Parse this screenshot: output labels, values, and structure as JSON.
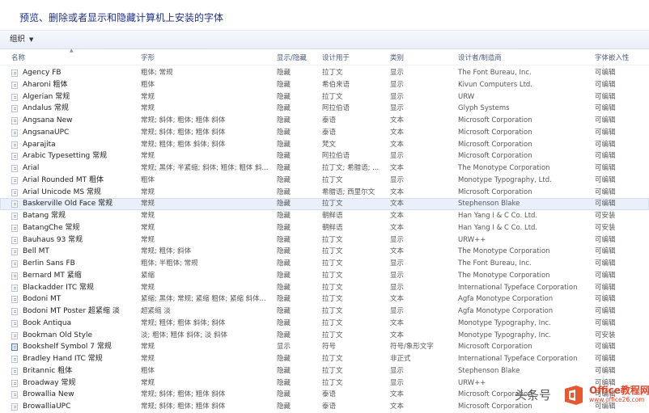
{
  "header": {
    "title": "预览、删除或者显示和隐藏计算机上安装的字体"
  },
  "toolbar": {
    "organize_label": "组织"
  },
  "columns": [
    "名称",
    "字形",
    "显示/隐藏",
    "设计用于",
    "类别",
    "设计者/制造商",
    "字体嵌入性"
  ],
  "rows": [
    [
      "Agency FB",
      "粗体; 常规",
      "隐藏",
      "拉丁文",
      "显示",
      "The Font Bureau, Inc.",
      "可编辑"
    ],
    [
      "Aharoni 粗体",
      "粗体",
      "隐藏",
      "希伯来语",
      "显示",
      "Kivun Computers Ltd.",
      "可编辑"
    ],
    [
      "Algerian 常规",
      "常规",
      "隐藏",
      "拉丁文",
      "显示",
      "URW",
      "可编辑"
    ],
    [
      "Andalus 常规",
      "常规",
      "隐藏",
      "阿拉伯语",
      "显示",
      "Glyph Systems",
      "可编辑"
    ],
    [
      "Angsana New",
      "常规; 斜体; 粗体; 粗体 斜体",
      "隐藏",
      "泰语",
      "文本",
      "Microsoft Corporation",
      "可编辑"
    ],
    [
      "AngsanaUPC",
      "常规; 斜体; 粗体; 粗体 斜体",
      "隐藏",
      "泰语",
      "文本",
      "Microsoft Corporation",
      "可编辑"
    ],
    [
      "Aparajita",
      "常规; 粗体; 粗体 斜体; 斜体",
      "隐藏",
      "梵文",
      "文本",
      "Microsoft Corporation",
      "可编辑"
    ],
    [
      "Arabic Typesetting 常规",
      "常规",
      "隐藏",
      "阿拉伯语",
      "显示",
      "Microsoft Corporation",
      "可编辑"
    ],
    [
      "Arial",
      "常规; 黑体; 半紧缩; 斜体; 粗体; 粗体 斜...",
      "隐藏",
      "拉丁文; 希腊语; ...",
      "文本",
      "The Monotype Corporation",
      "可编辑"
    ],
    [
      "Arial Rounded MT 粗体",
      "粗体",
      "隐藏",
      "拉丁文",
      "显示",
      "Monotype Typography, Ltd.",
      "可编辑"
    ],
    [
      "Arial Unicode MS 常规",
      "常规",
      "隐藏",
      "希腊语; 西里尔文",
      "文本",
      "Microsoft Corporation",
      "可编辑"
    ],
    [
      "Baskerville Old Face 常规",
      "常规",
      "隐藏",
      "拉丁文",
      "文本",
      "Stephenson Blake",
      "可编辑"
    ],
    [
      "Batang 常规",
      "常规",
      "隐藏",
      "朝鲜语",
      "文本",
      "Han Yang I & C Co. Ltd.",
      "可安装"
    ],
    [
      "BatangChe 常规",
      "常规",
      "隐藏",
      "朝鲜语",
      "文本",
      "Han Yang I & C Co. Ltd.",
      "可安装"
    ],
    [
      "Bauhaus 93 常规",
      "常规",
      "隐藏",
      "拉丁文",
      "显示",
      "URW++",
      "可编辑"
    ],
    [
      "Bell MT",
      "常规; 粗体; 斜体",
      "隐藏",
      "拉丁文",
      "文本",
      "The Monotype Corporation",
      "可编辑"
    ],
    [
      "Berlin Sans FB",
      "粗体; 半粗体; 常规",
      "隐藏",
      "拉丁文",
      "显示",
      "The Font Bureau, Inc.",
      "可编辑"
    ],
    [
      "Bernard MT 紧缩",
      "紧缩",
      "隐藏",
      "拉丁文",
      "显示",
      "The Monotype Corporation",
      "可编辑"
    ],
    [
      "Blackadder ITC 常规",
      "常规",
      "隐藏",
      "拉丁文",
      "显示",
      "International Typeface Corporation",
      "可编辑"
    ],
    [
      "Bodoni MT",
      "紧缩; 黑体; 常规; 紧缩 粗体; 紧缩 斜体...",
      "隐藏",
      "拉丁文",
      "文本",
      "Agfa Monotype Corporation",
      "可编辑"
    ],
    [
      "Bodoni MT Poster 超紧缩 淡",
      "超紧缩 淡",
      "隐藏",
      "拉丁文",
      "显示",
      "Agfa Monotype Corporation",
      "可编辑"
    ],
    [
      "Book Antiqua",
      "常规; 粗体; 粗体 斜体; 斜体",
      "隐藏",
      "拉丁文",
      "文本",
      "Monotype Typography, Inc.",
      "可编辑"
    ],
    [
      "Bookman Old Style",
      "淡; 粗体; 粗体 斜体; 淡 斜体",
      "隐藏",
      "拉丁文",
      "文本",
      "Monotype Typography, Inc.",
      "可安装"
    ],
    [
      "Bookshelf Symbol 7 常规",
      "常规",
      "显示",
      "符号",
      "符号/象形文字",
      "Microsoft Corporation",
      "可编辑"
    ],
    [
      "Bradley Hand ITC 常规",
      "常规",
      "隐藏",
      "拉丁文",
      "非正式",
      "International Typeface Corporation",
      "可编辑"
    ],
    [
      "Britannic 粗体",
      "粗体",
      "隐藏",
      "拉丁文",
      "显示",
      "Stephenson Blake",
      "可编辑"
    ],
    [
      "Broadway 常规",
      "常规",
      "隐藏",
      "拉丁文",
      "显示",
      "URW++",
      "可编辑"
    ],
    [
      "Browallia New",
      "常规; 斜体; 粗体; 粗体 斜体",
      "隐藏",
      "泰语",
      "文本",
      "Microsoft Corporation",
      "可编辑"
    ],
    [
      "BrowalliaUPC",
      "常规; 斜体; 粗体; 粗体 斜体",
      "隐藏",
      "泰语",
      "文本",
      "Microsoft Corporation",
      "可编辑"
    ]
  ],
  "selected_row": 11,
  "icon_names": [
    "font-file-icon",
    "symbol-font-icon",
    "chevron-down-icon"
  ],
  "watermark": {
    "text1": "头条号",
    "text2": "Office教程网",
    "url": "www.office26.com"
  }
}
